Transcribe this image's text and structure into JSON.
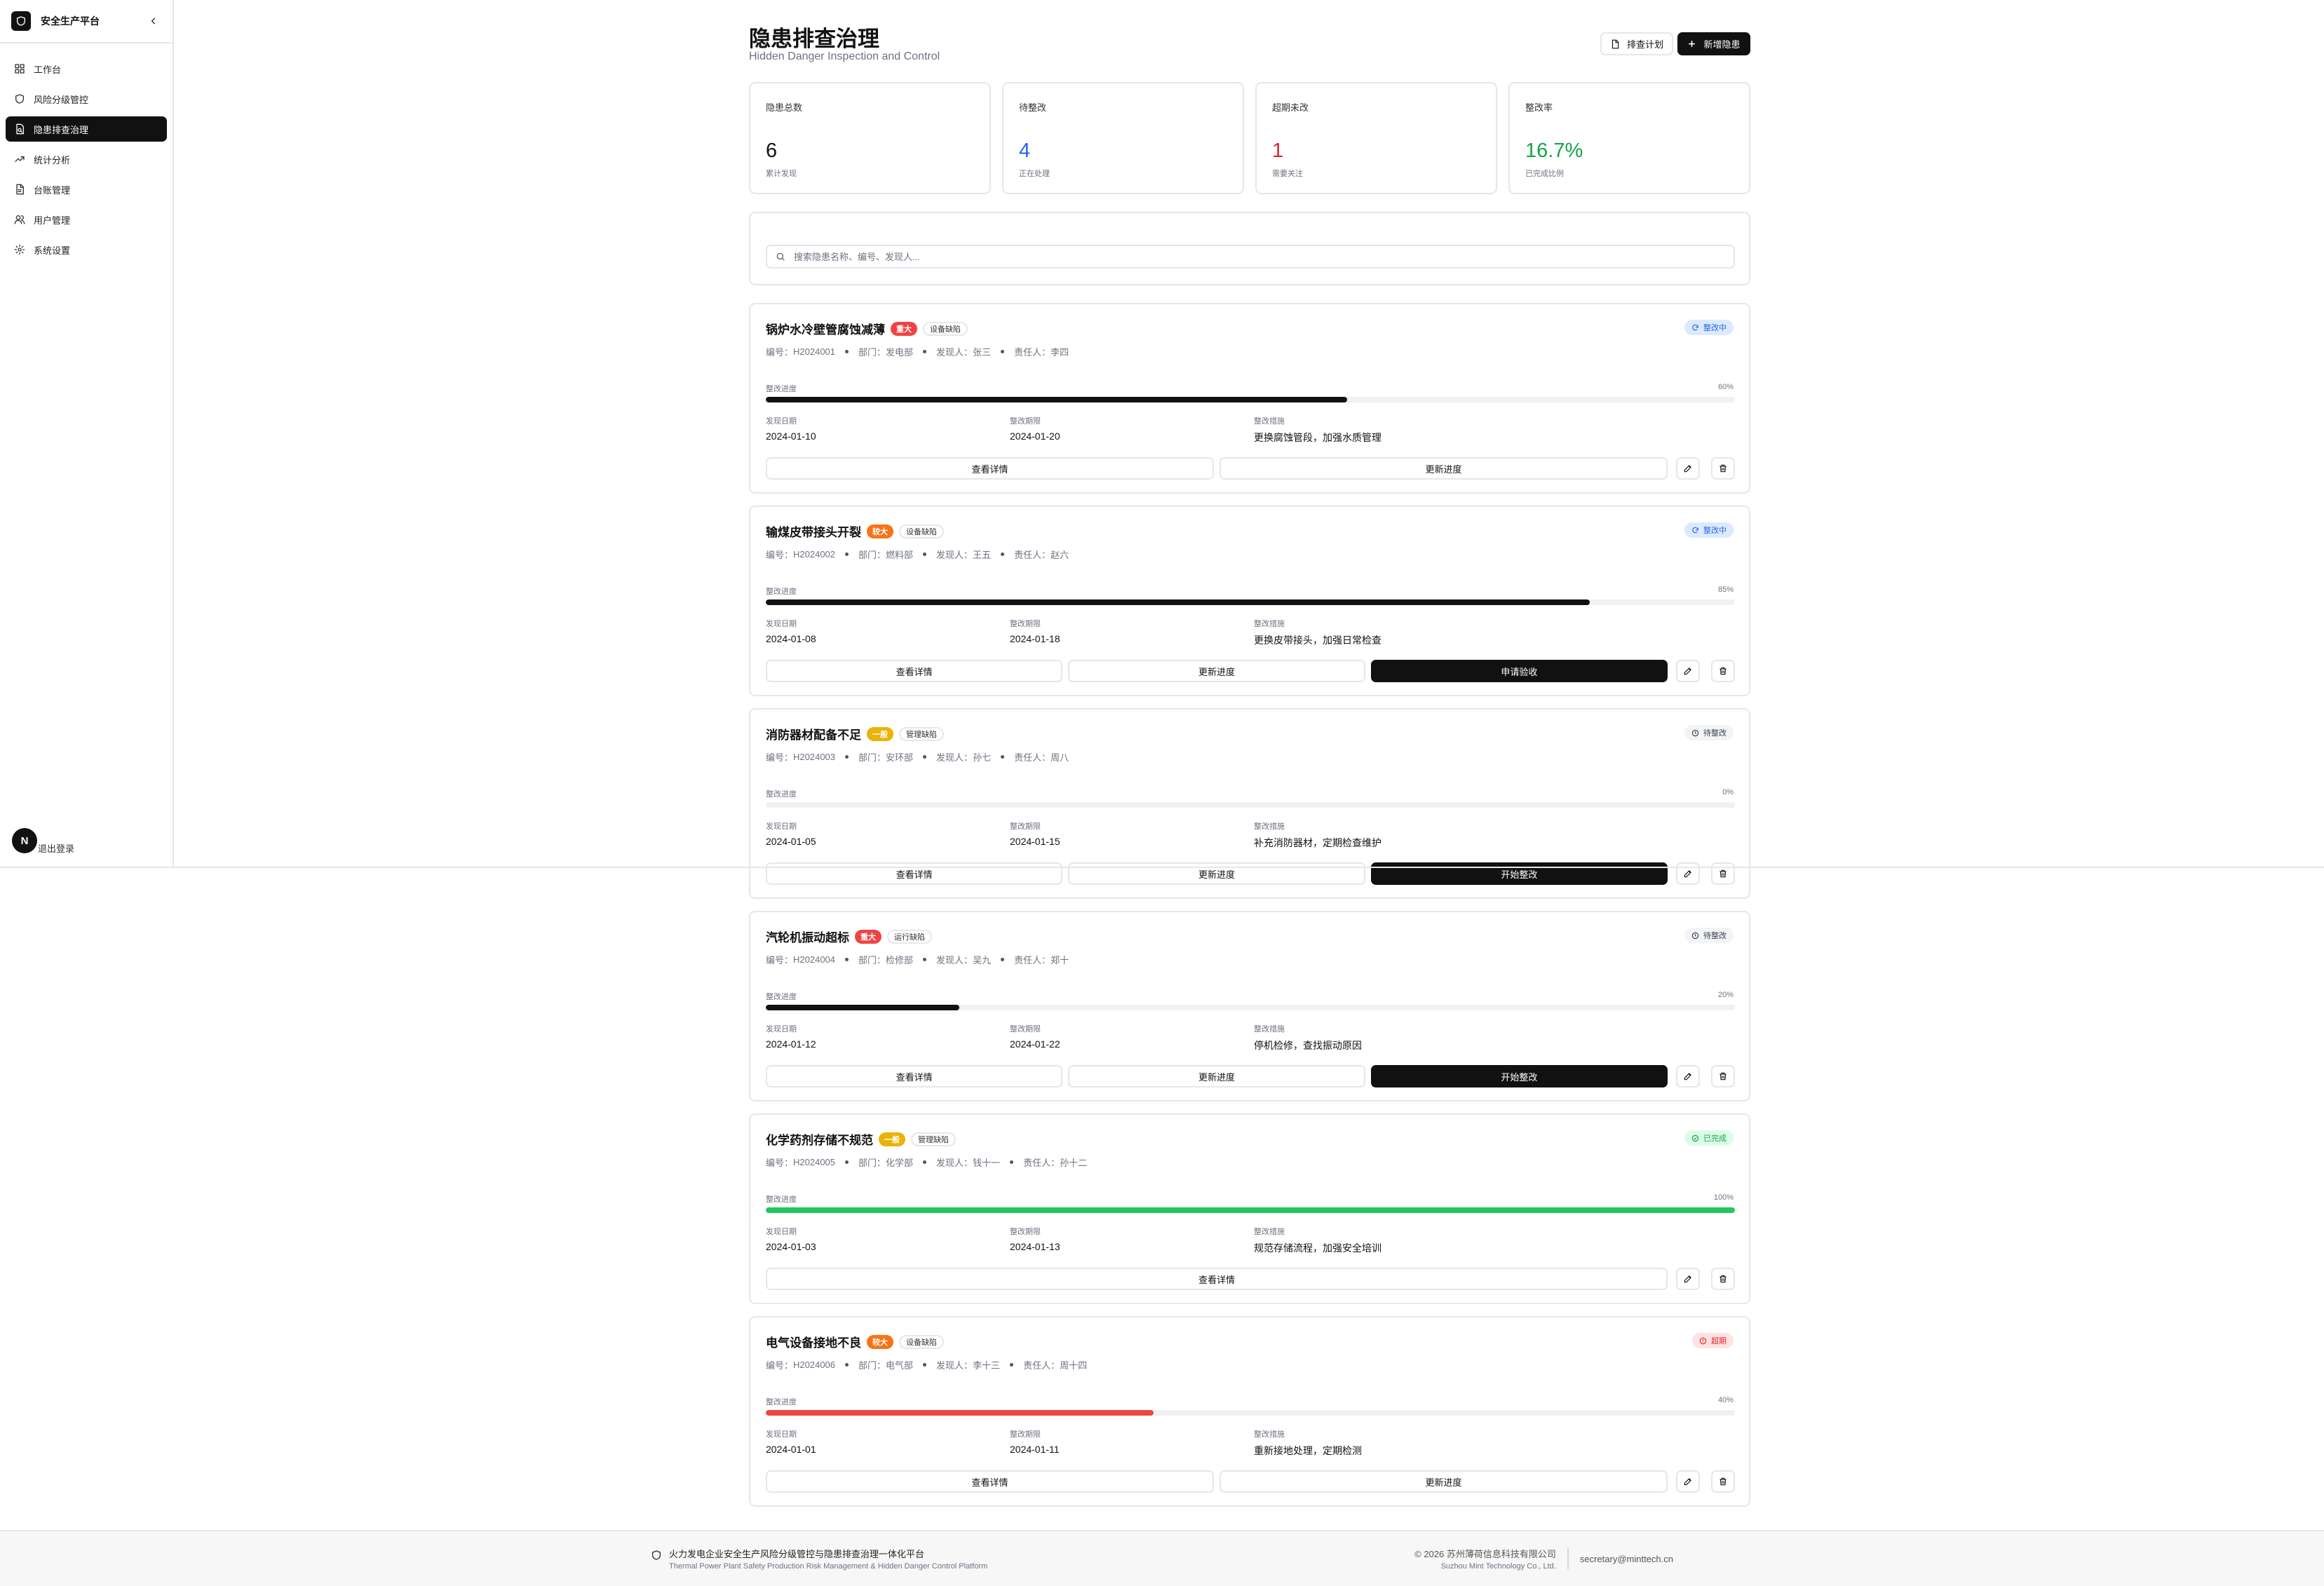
{
  "sidebar": {
    "title": "安全生产平台",
    "items": [
      {
        "label": "工作台",
        "icon": "dashboard-icon"
      },
      {
        "label": "风险分级管控",
        "icon": "shield-icon"
      },
      {
        "label": "隐患排查治理",
        "icon": "file-search-icon",
        "active": true
      },
      {
        "label": "统计分析",
        "icon": "trending-up-icon"
      },
      {
        "label": "台账管理",
        "icon": "document-icon"
      },
      {
        "label": "用户管理",
        "icon": "users-icon"
      },
      {
        "label": "系统设置",
        "icon": "gear-icon"
      }
    ],
    "logout": "退出登录",
    "avatar_letter": "N"
  },
  "header": {
    "title": "隐患排查治理",
    "subtitle": "Hidden Danger Inspection and Control",
    "plan_button": "排查计划",
    "add_button": "新增隐患"
  },
  "stats": [
    {
      "label": "隐患总数",
      "value": "6",
      "note": "累计发现",
      "color": "#111111"
    },
    {
      "label": "待整改",
      "value": "4",
      "note": "正在处理",
      "color": "#2563eb"
    },
    {
      "label": "超期未改",
      "value": "1",
      "note": "需要关注",
      "color": "#dc2626"
    },
    {
      "label": "整改率",
      "value": "16.7%",
      "note": "已完成比例",
      "color": "#16a34a"
    }
  ],
  "search": {
    "placeholder": "搜索隐患名称、编号、发现人..."
  },
  "labels": {
    "code": "编号：",
    "dept": "部门：",
    "finder": "发现人：",
    "owner": "责任人：",
    "progress": "整改进度",
    "found_date": "发现日期",
    "deadline": "整改期限",
    "measure": "整改措施"
  },
  "colors": {
    "major": "#ef4444",
    "larger": "#f97316",
    "general": "#eab308",
    "bar_default": "#111111",
    "bar_done": "#22c55e",
    "bar_overdue": "#ef4444"
  },
  "hazards": [
    {
      "name": "锅炉水冷壁管腐蚀减薄",
      "severity": "重大",
      "severity_color": "#ef4444",
      "category": "设备缺陷",
      "status": "整改中",
      "status_kind": "progress",
      "code": "H2024001",
      "dept": "发电部",
      "finder": "张三",
      "owner": "李四",
      "progress": 60,
      "progress_text": "60%",
      "bar_color": "#111111",
      "found_date": "2024-01-10",
      "deadline": "2024-01-20",
      "measure": "更换腐蚀管段，加强水质管理",
      "actions": [
        {
          "label": "查看详情",
          "dark": false
        },
        {
          "label": "更新进度",
          "dark": false
        }
      ]
    },
    {
      "name": "输煤皮带接头开裂",
      "severity": "较大",
      "severity_color": "#f97316",
      "category": "设备缺陷",
      "status": "整改中",
      "status_kind": "progress",
      "code": "H2024002",
      "dept": "燃料部",
      "finder": "王五",
      "owner": "赵六",
      "progress": 85,
      "progress_text": "85%",
      "bar_color": "#111111",
      "found_date": "2024-01-08",
      "deadline": "2024-01-18",
      "measure": "更换皮带接头，加强日常检查",
      "actions": [
        {
          "label": "查看详情",
          "dark": false
        },
        {
          "label": "更新进度",
          "dark": false
        },
        {
          "label": "申请验收",
          "dark": true
        }
      ]
    },
    {
      "name": "消防器材配备不足",
      "severity": "一般",
      "severity_color": "#eab308",
      "category": "管理缺陷",
      "status": "待整改",
      "status_kind": "pending",
      "code": "H2024003",
      "dept": "安环部",
      "finder": "孙七",
      "owner": "周八",
      "progress": 0,
      "progress_text": "0%",
      "bar_color": "#111111",
      "found_date": "2024-01-05",
      "deadline": "2024-01-15",
      "measure": "补充消防器材，定期检查维护",
      "actions": [
        {
          "label": "查看详情",
          "dark": false
        },
        {
          "label": "更新进度",
          "dark": false
        },
        {
          "label": "开始整改",
          "dark": true
        }
      ]
    },
    {
      "name": "汽轮机振动超标",
      "severity": "重大",
      "severity_color": "#ef4444",
      "category": "运行缺陷",
      "status": "待整改",
      "status_kind": "pending",
      "code": "H2024004",
      "dept": "检修部",
      "finder": "吴九",
      "owner": "郑十",
      "progress": 20,
      "progress_text": "20%",
      "bar_color": "#111111",
      "found_date": "2024-01-12",
      "deadline": "2024-01-22",
      "measure": "停机检修，查找振动原因",
      "actions": [
        {
          "label": "查看详情",
          "dark": false
        },
        {
          "label": "更新进度",
          "dark": false
        },
        {
          "label": "开始整改",
          "dark": true
        }
      ]
    },
    {
      "name": "化学药剂存储不规范",
      "severity": "一般",
      "severity_color": "#eab308",
      "category": "管理缺陷",
      "status": "已完成",
      "status_kind": "done",
      "code": "H2024005",
      "dept": "化学部",
      "finder": "钱十一",
      "owner": "孙十二",
      "progress": 100,
      "progress_text": "100%",
      "bar_color": "#22c55e",
      "found_date": "2024-01-03",
      "deadline": "2024-01-13",
      "measure": "规范存储流程，加强安全培训",
      "actions": [
        {
          "label": "查看详情",
          "dark": false
        }
      ]
    },
    {
      "name": "电气设备接地不良",
      "severity": "较大",
      "severity_color": "#f97316",
      "category": "设备缺陷",
      "status": "超期",
      "status_kind": "overdue",
      "code": "H2024006",
      "dept": "电气部",
      "finder": "李十三",
      "owner": "周十四",
      "progress": 40,
      "progress_text": "40%",
      "bar_color": "#ef4444",
      "found_date": "2024-01-01",
      "deadline": "2024-01-11",
      "measure": "重新接地处理，定期检测",
      "actions": [
        {
          "label": "查看详情",
          "dark": false
        },
        {
          "label": "更新进度",
          "dark": false
        }
      ]
    }
  ],
  "footer": {
    "platform_cn": "火力发电企业安全生产风险分级管控与隐患排查治理一体化平台",
    "platform_en": "Thermal Power Plant Safety Production Risk Management & Hidden Danger Control Platform",
    "copyright_cn": "© 2026 苏州薄荷信息科技有限公司",
    "copyright_en": "Suzhou Mint Technology Co., Ltd.",
    "email": "secretary@minttech.cn"
  }
}
